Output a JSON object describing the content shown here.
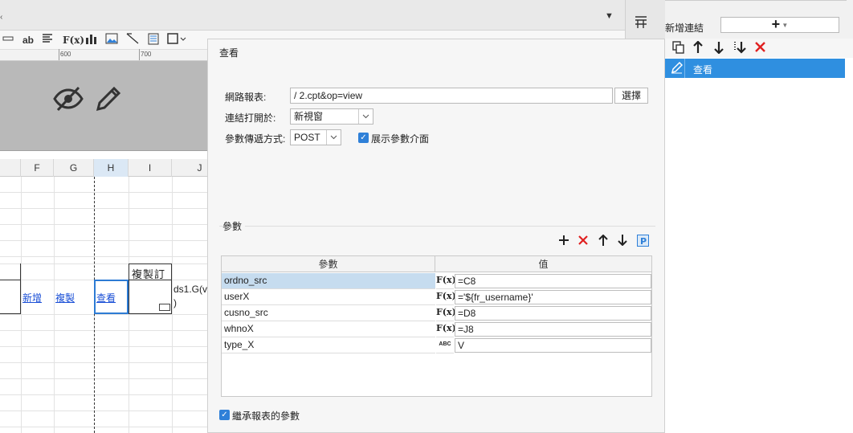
{
  "toolbar": {
    "text_tool": "ab",
    "formula_tool": "F(x)"
  },
  "ruler": {
    "labels": [
      "600",
      "700"
    ]
  },
  "grid": {
    "columns": [
      "F",
      "G",
      "H",
      "I",
      "J"
    ],
    "header_cell": "複製訂",
    "links": [
      "新增",
      "複製",
      "查看"
    ],
    "formula_text": "ds1.G(v",
    "formula_text2": ")"
  },
  "dialog": {
    "title": "查看",
    "report_label": "網路報表:",
    "report_value": "/                        2.cpt&op=view",
    "choose_button": "選擇",
    "open_label": "連結打開於:",
    "open_value": "新視窗",
    "method_label": "參數傳遞方式:",
    "method_value": "POST",
    "show_params_label": "展示參數介面",
    "params_title": "參數",
    "table_headers": [
      "參數",
      "值"
    ],
    "params": [
      {
        "name": "ordno_src",
        "type": "F(x)",
        "value": "=C8"
      },
      {
        "name": "userX",
        "type": "F(x)",
        "value": "='${fr_username}'"
      },
      {
        "name": "cusno_src",
        "type": "F(x)",
        "value": "=D8"
      },
      {
        "name": "whnoX",
        "type": "F(x)",
        "value": "=J8"
      },
      {
        "name": "type_X",
        "type": "ABC",
        "value": "V"
      }
    ],
    "inherit_label": "繼承報表的參數"
  },
  "right_panel": {
    "new_link_label": "新增連結",
    "add_glyph": "+",
    "item_label": "查看"
  },
  "colors": {
    "accent": "#2f8fe0",
    "selected_row": "#c6dcef",
    "delete": "#e02020"
  }
}
